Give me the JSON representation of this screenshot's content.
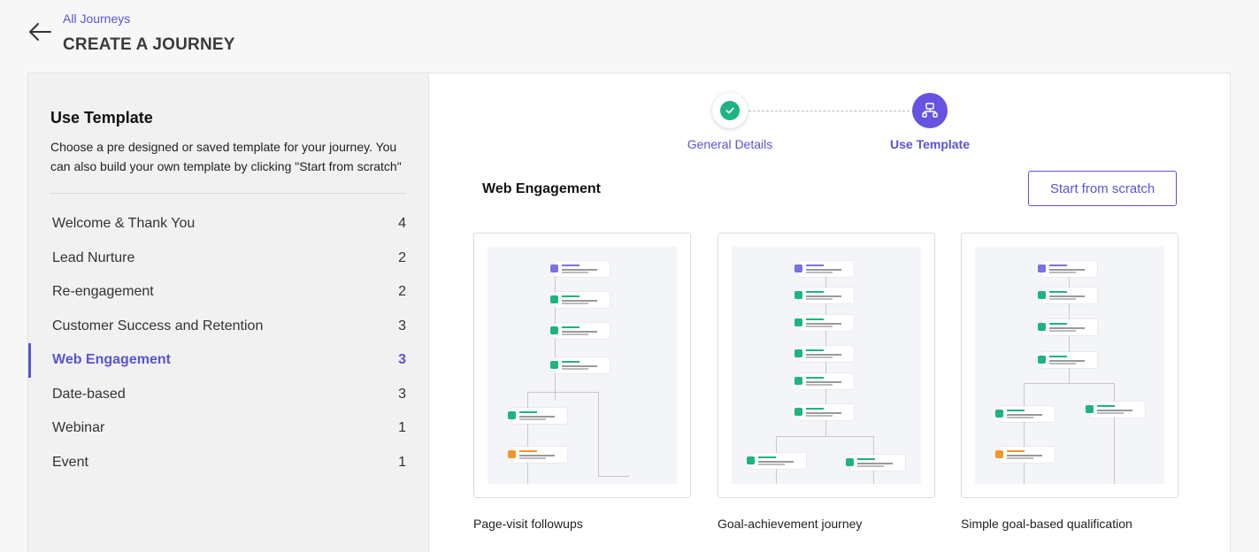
{
  "header": {
    "breadcrumb": "All Journeys",
    "title": "CREATE A JOURNEY",
    "back_icon": "arrow-left-icon"
  },
  "sidebar": {
    "title": "Use Template",
    "description": "Choose a pre designed or saved template for your journey. You can also build your own template by clicking \"Start from scratch\"",
    "categories": [
      {
        "label": "Welcome & Thank You",
        "count": "4"
      },
      {
        "label": "Lead Nurture",
        "count": "2"
      },
      {
        "label": "Re-engagement",
        "count": "2"
      },
      {
        "label": "Customer Success and Retention",
        "count": "3"
      },
      {
        "label": "Web Engagement",
        "count": "3"
      },
      {
        "label": "Date-based",
        "count": "3"
      },
      {
        "label": "Webinar",
        "count": "1"
      },
      {
        "label": "Event",
        "count": "1"
      }
    ],
    "active_index": 4
  },
  "stepper": {
    "steps": [
      {
        "label": "General Details",
        "state": "done",
        "icon": "check-icon"
      },
      {
        "label": "Use Template",
        "state": "current",
        "icon": "template-icon"
      }
    ]
  },
  "main": {
    "section_title": "Web Engagement",
    "scratch_button": "Start from scratch",
    "templates": [
      {
        "name": "Page-visit followups"
      },
      {
        "name": "Goal-achievement journey"
      },
      {
        "name": "Simple goal-based qualification"
      }
    ]
  },
  "colors": {
    "accent": "#5b52d6",
    "success": "#1fb37f",
    "node_green": "#1fb37f",
    "node_orange": "#f0962a"
  }
}
